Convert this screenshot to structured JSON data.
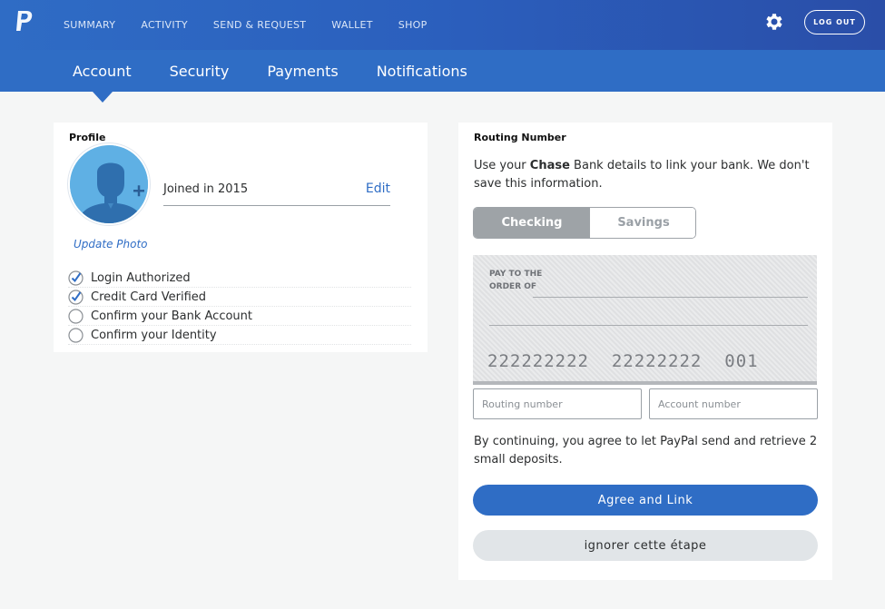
{
  "topnav": {
    "items": [
      "SUMMARY",
      "ACTIVITY",
      "SEND & REQUEST",
      "WALLET",
      "SHOP"
    ],
    "logout_label": "LOG OUT"
  },
  "subnav": {
    "items": [
      "Account",
      "Security",
      "Payments",
      "Notifications"
    ],
    "active": "Account"
  },
  "profile": {
    "title": "Profile",
    "joined": "Joined in 2015",
    "edit_label": "Edit",
    "update_photo_label": "Update Photo",
    "checklist": [
      {
        "label": "Login Authorized",
        "checked": true
      },
      {
        "label": "Credit Card Verified",
        "checked": true
      },
      {
        "label": "Confirm your Bank Account",
        "checked": false
      },
      {
        "label": "Confirm your Identity",
        "checked": false
      }
    ]
  },
  "routing": {
    "title": "Routing Number",
    "desc_before": "Use your ",
    "bank": "Chase",
    "desc_after": " Bank details to link your bank. We don't save this information.",
    "tabs": [
      "Checking",
      "Savings"
    ],
    "active_tab": "Checking",
    "cheque": {
      "pay_to_line1": "PAY TO THE",
      "pay_to_line2": "ORDER OF",
      "routing_digits": "222222222",
      "account_digits": "22222222",
      "check_number": "001"
    },
    "routing_placeholder": "Routing number",
    "account_placeholder": "Account number",
    "consent": "By continuing, you agree to let PayPal send and retrieve 2 small deposits.",
    "agree_label": "Agree and Link",
    "skip_label": "ignorer cette étape"
  },
  "colors": {
    "brand_blue": "#2f6dc5",
    "avatar_blue": "#5fb0e4"
  }
}
